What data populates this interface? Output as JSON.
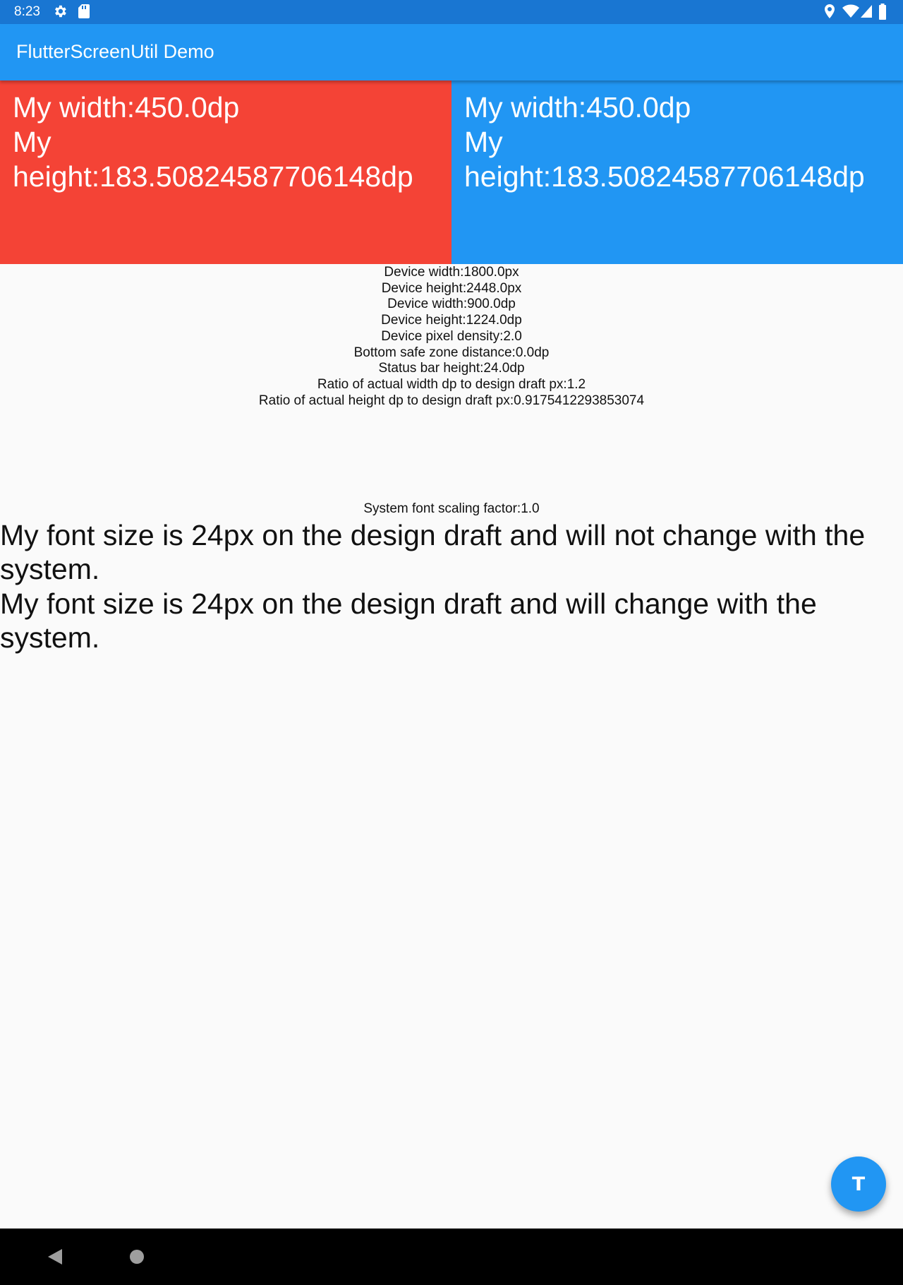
{
  "status_bar": {
    "time": "8:23",
    "icons": [
      "settings-icon",
      "sd-card-icon",
      "location-icon",
      "wifi-icon",
      "signal-icon",
      "battery-icon"
    ]
  },
  "app_bar": {
    "title": "FlutterScreenUtil Demo",
    "color": "#2196f3"
  },
  "boxes": [
    {
      "color": "#f44336",
      "width_text": "My width:450.0dp",
      "height_word": "My",
      "height_value": "height:183.50824587706148dp"
    },
    {
      "color": "#2196f3",
      "width_text": "My width:450.0dp",
      "height_word": "My",
      "height_value": "height:183.50824587706148dp"
    }
  ],
  "info_lines": [
    "Device width:1800.0px",
    "Device height:2448.0px",
    "Device width:900.0dp",
    "Device height:1224.0dp",
    "Device pixel density:2.0",
    "Bottom safe zone distance:0.0dp",
    "Status bar height:24.0dp",
    "Ratio of actual width dp to design draft px:1.2",
    "Ratio of actual height dp to design draft px:0.9175412293853074"
  ],
  "font_scale_text": "System font scaling factor:1.0",
  "font_text_fixed": "My font size is 24px on the design draft and will not change with the system.",
  "font_text_scaling": "My font size is 24px on the design draft and will change with the system.",
  "fab": {
    "label": "T",
    "color": "#2196f3"
  },
  "nav_bar": {
    "icons": [
      "back-icon",
      "home-icon"
    ]
  }
}
